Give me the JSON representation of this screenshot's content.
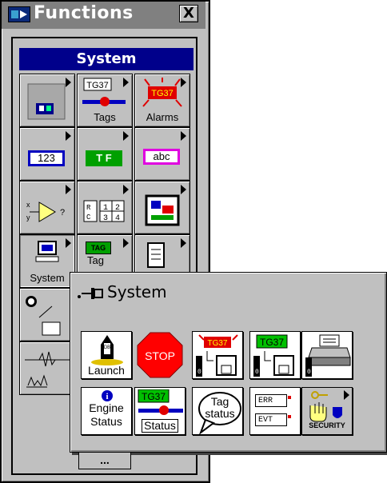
{
  "functions_window": {
    "title": "Functions",
    "close_label": "X",
    "category_header": "System",
    "cells": [
      {
        "caption": "",
        "icon": "panel-icon"
      },
      {
        "caption": "Tags",
        "badge": "TG37",
        "icon": "tags-icon"
      },
      {
        "caption": "Alarms",
        "badge": "TG37",
        "icon": "alarms-icon"
      },
      {
        "caption": "123",
        "icon": "numeric-icon"
      },
      {
        "caption": "T F",
        "icon": "boolean-icon"
      },
      {
        "caption": "abc",
        "icon": "string-icon"
      },
      {
        "caption": "",
        "icon": "comparison-icon"
      },
      {
        "caption": "",
        "icon": "array-icon"
      },
      {
        "caption": "",
        "icon": "cluster-icon"
      },
      {
        "caption": "System",
        "icon": "computer-icon"
      },
      {
        "caption": "Tag",
        "badge": "TAG",
        "icon": "tag-icon"
      },
      {
        "caption": "",
        "icon": "file-icon"
      },
      {
        "caption": "",
        "icon": "timing-icon"
      },
      {
        "caption": "",
        "icon": "waveform-icon"
      },
      {
        "caption": "",
        "icon": "analysis-icon"
      }
    ],
    "bottom_button": "..."
  },
  "system_palette": {
    "title": "System",
    "items": [
      {
        "label": "Launch",
        "badge": "DB",
        "icon": "launch-rocket-icon"
      },
      {
        "label": "STOP",
        "icon": "stop-sign-icon"
      },
      {
        "label": "",
        "badge": "TG37",
        "icon": "alarm-log-icon"
      },
      {
        "label": "",
        "badge": "TG37",
        "icon": "tag-log-icon"
      },
      {
        "label": "",
        "icon": "printer-icon"
      },
      {
        "label": "Engine Status",
        "line1": "Engine",
        "line2": "Status",
        "icon": "engine-status-icon"
      },
      {
        "label": "Status",
        "badge": "TG37",
        "icon": "tag-status-icon"
      },
      {
        "label": "Tag status",
        "line1": "Tag",
        "line2": "status",
        "icon": "tag-status-bubble-icon"
      },
      {
        "label": "ERR EVT",
        "line1": "ERR",
        "line2": "EVT",
        "icon": "error-event-icon"
      },
      {
        "label": "SECURITY",
        "icon": "security-icon"
      }
    ]
  },
  "colors": {
    "header_blue": "#00008b",
    "tag_red": "#e00000",
    "tag_green": "#00a000",
    "magenta": "#e000e0"
  }
}
